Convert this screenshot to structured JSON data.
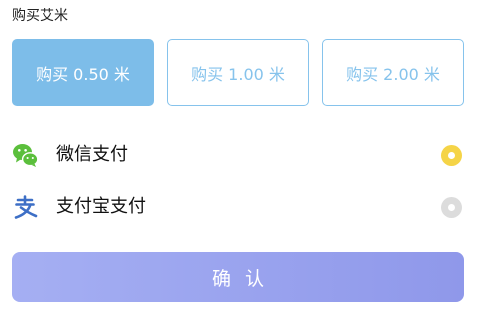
{
  "section": {
    "title": "购买艾米"
  },
  "options": [
    {
      "label": "购买 0.50 米",
      "selected": true
    },
    {
      "label": "购买 1.00 米",
      "selected": false
    },
    {
      "label": "购买 2.00 米",
      "selected": false
    }
  ],
  "payment_methods": [
    {
      "label": "微信支付",
      "icon": "wechat-icon",
      "selected": true
    },
    {
      "label": "支付宝支付",
      "icon": "alipay-icon",
      "selected": false
    }
  ],
  "confirm": {
    "label": "确认"
  },
  "colors": {
    "selected_option_bg": "#7dbde9",
    "option_border": "#86c3ec",
    "radio_selected": "#f5d447",
    "radio_unselected": "#dcdcdc",
    "wechat_green": "#5bbf3c",
    "alipay_blue": "#3d6fc6",
    "confirm_gradient_start": "#a5aff3",
    "confirm_gradient_end": "#8f98ea"
  }
}
